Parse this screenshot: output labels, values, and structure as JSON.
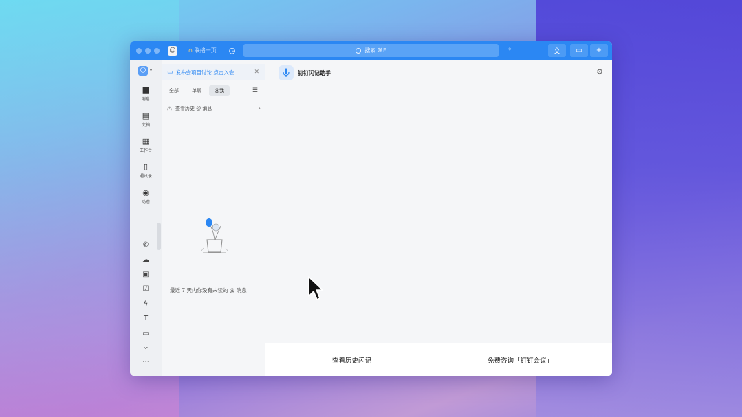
{
  "app": {
    "search_placeholder": "搜索 ⌘F",
    "org_label": "联络一页"
  },
  "nav": {
    "items": [
      {
        "label": "消息",
        "icon": "chat-icon"
      },
      {
        "label": "文档",
        "icon": "doc-icon"
      },
      {
        "label": "工作台",
        "icon": "grid-icon"
      },
      {
        "label": "通讯录",
        "icon": "contacts-icon"
      },
      {
        "label": "动态",
        "icon": "eye-icon"
      }
    ],
    "bottom_icons": [
      "phone-icon",
      "cloud-icon",
      "calendar-icon",
      "todo-icon",
      "ding-icon",
      "shirt-icon",
      "mail-icon",
      "apps-icon",
      "more-icon"
    ]
  },
  "panel": {
    "banner_text": "发布会项目讨论 点击入会",
    "tabs": [
      {
        "label": "全部",
        "active": false
      },
      {
        "label": "单聊",
        "active": false
      },
      {
        "label": "@我",
        "active": true
      }
    ],
    "history_row": "查看历史 @ 消息",
    "empty_text": "最近 7 天内你没有未读的 @ 消息"
  },
  "main": {
    "title": "钉钉闪记助手",
    "footer_left": "查看历史闪记",
    "footer_right": "免费咨询「钉钉会议」"
  },
  "colors": {
    "titlebar": "#2b87f3",
    "accent": "#2b87f3"
  }
}
